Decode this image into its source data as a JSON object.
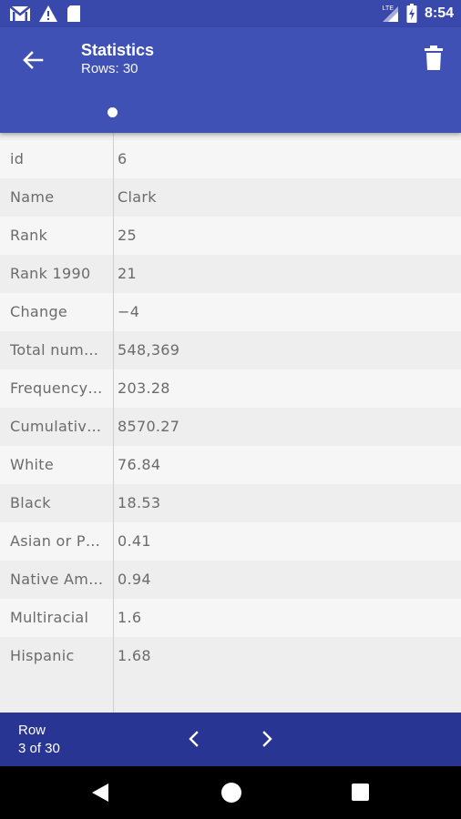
{
  "status_bar": {
    "time": "8:54",
    "network_label": "LTE",
    "icons": [
      "gmail-icon",
      "warning-icon",
      "sd-card-icon",
      "signal-icon",
      "battery-icon"
    ]
  },
  "app_bar": {
    "title": "Statistics",
    "subtitle": "Rows: 30",
    "icons": [
      "back-arrow-icon",
      "delete-icon"
    ]
  },
  "table": {
    "rows": [
      {
        "key": "id",
        "value": "6"
      },
      {
        "key": "Name",
        "value": "Clark"
      },
      {
        "key": "Rank",
        "value": "25"
      },
      {
        "key": "Rank 1990",
        "value": "21"
      },
      {
        "key": "Change",
        "value": "−4"
      },
      {
        "key": "Total num…",
        "value": "548,369"
      },
      {
        "key": "Frequency…",
        "value": "203.28"
      },
      {
        "key": "Cumulativ…",
        "value": "8570.27"
      },
      {
        "key": "White",
        "value": "76.84"
      },
      {
        "key": "Black",
        "value": "18.53"
      },
      {
        "key": "Asian or P…",
        "value": "0.41"
      },
      {
        "key": "Native Am…",
        "value": "0.94"
      },
      {
        "key": "Multiracial",
        "value": "1.6"
      },
      {
        "key": "Hispanic",
        "value": "1.68"
      }
    ]
  },
  "bottom_bar": {
    "label": "Row",
    "position": "3 of 30",
    "icons": [
      "chevron-left-icon",
      "chevron-right-icon"
    ]
  },
  "colors": {
    "app_bar": "#3f51b5",
    "status_bar": "#3949ab",
    "bottom_bar": "#283593",
    "text": "#6b6b6b"
  }
}
